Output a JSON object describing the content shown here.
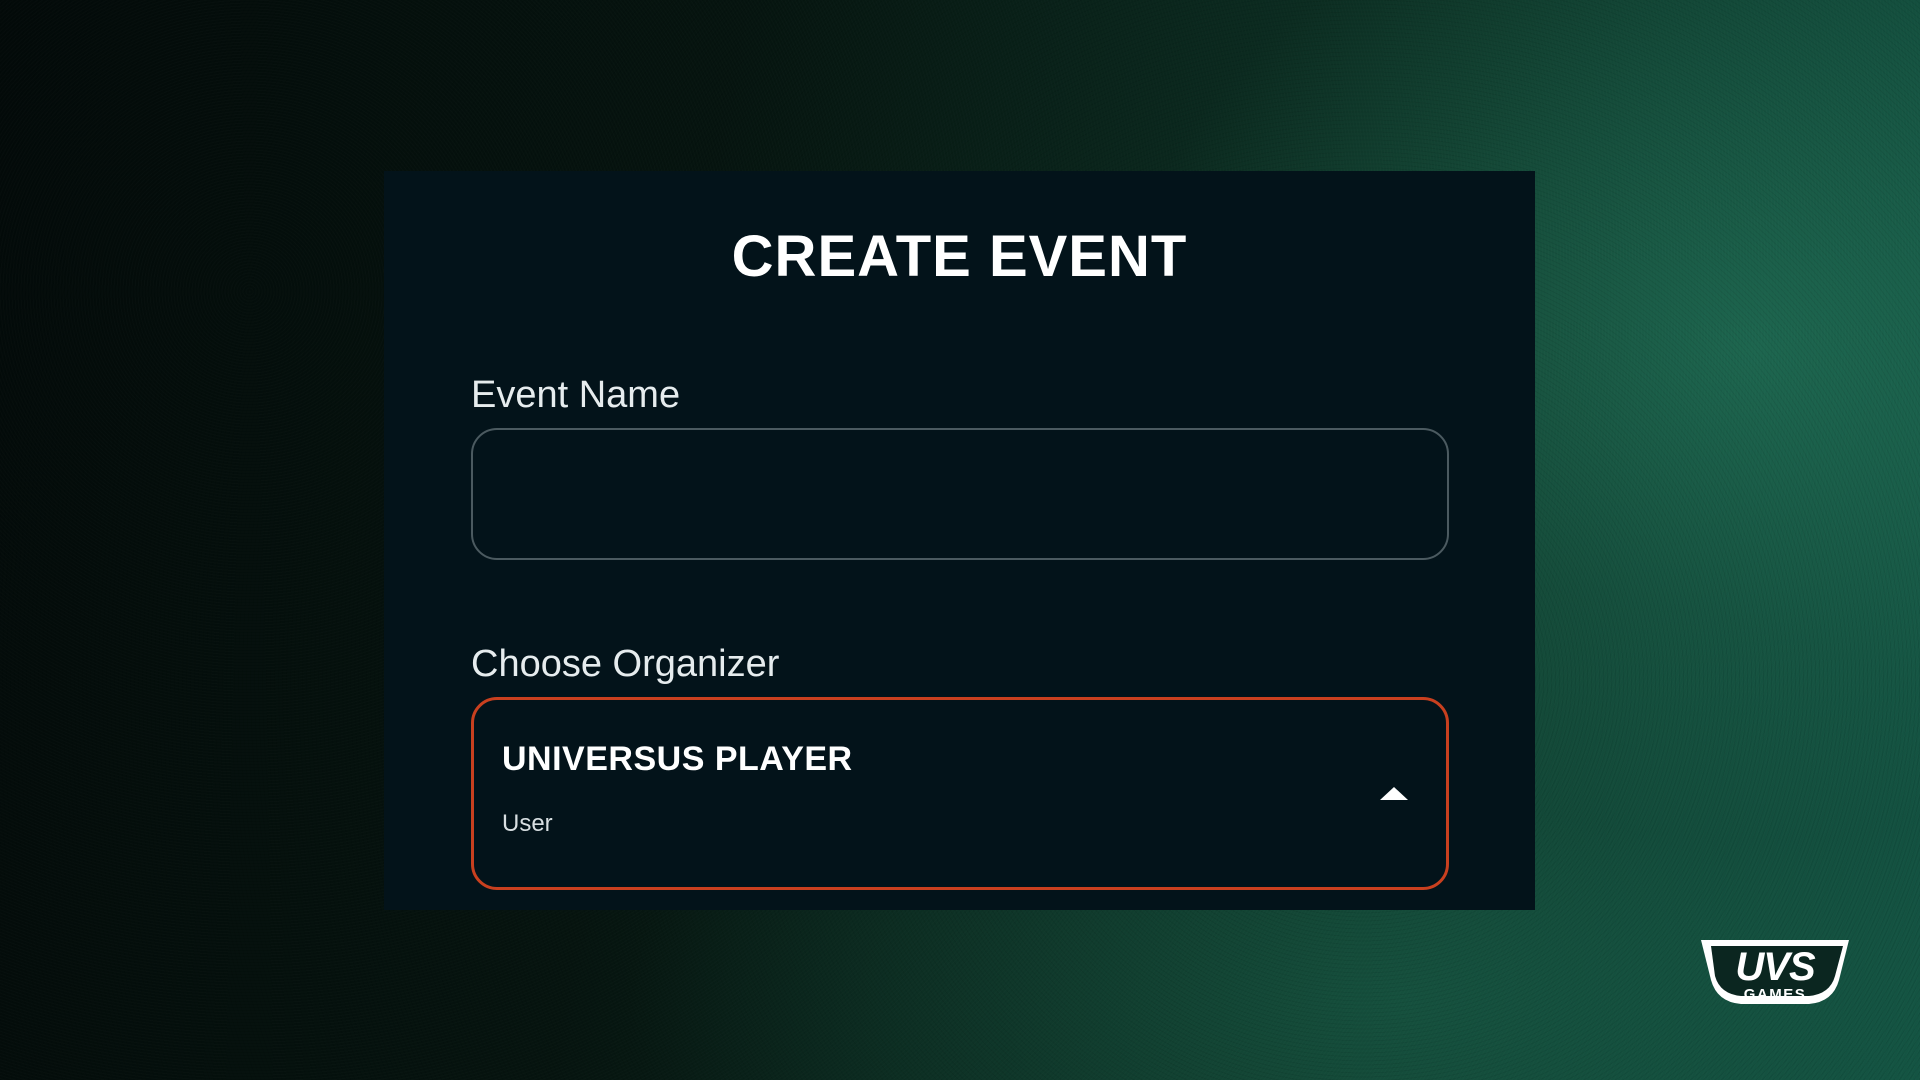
{
  "dialog": {
    "title": "CREATE EVENT"
  },
  "event_name": {
    "label": "Event Name",
    "value": "",
    "placeholder": ""
  },
  "organizer": {
    "label": "Choose Organizer",
    "selected_name": "UNIVERSUS PLAYER",
    "selected_role": "User",
    "caret_icon": "chevron-up-icon",
    "border_color": "#c9401f"
  },
  "brand": {
    "logo_text": "UVS",
    "logo_subtext": "GAMES"
  }
}
